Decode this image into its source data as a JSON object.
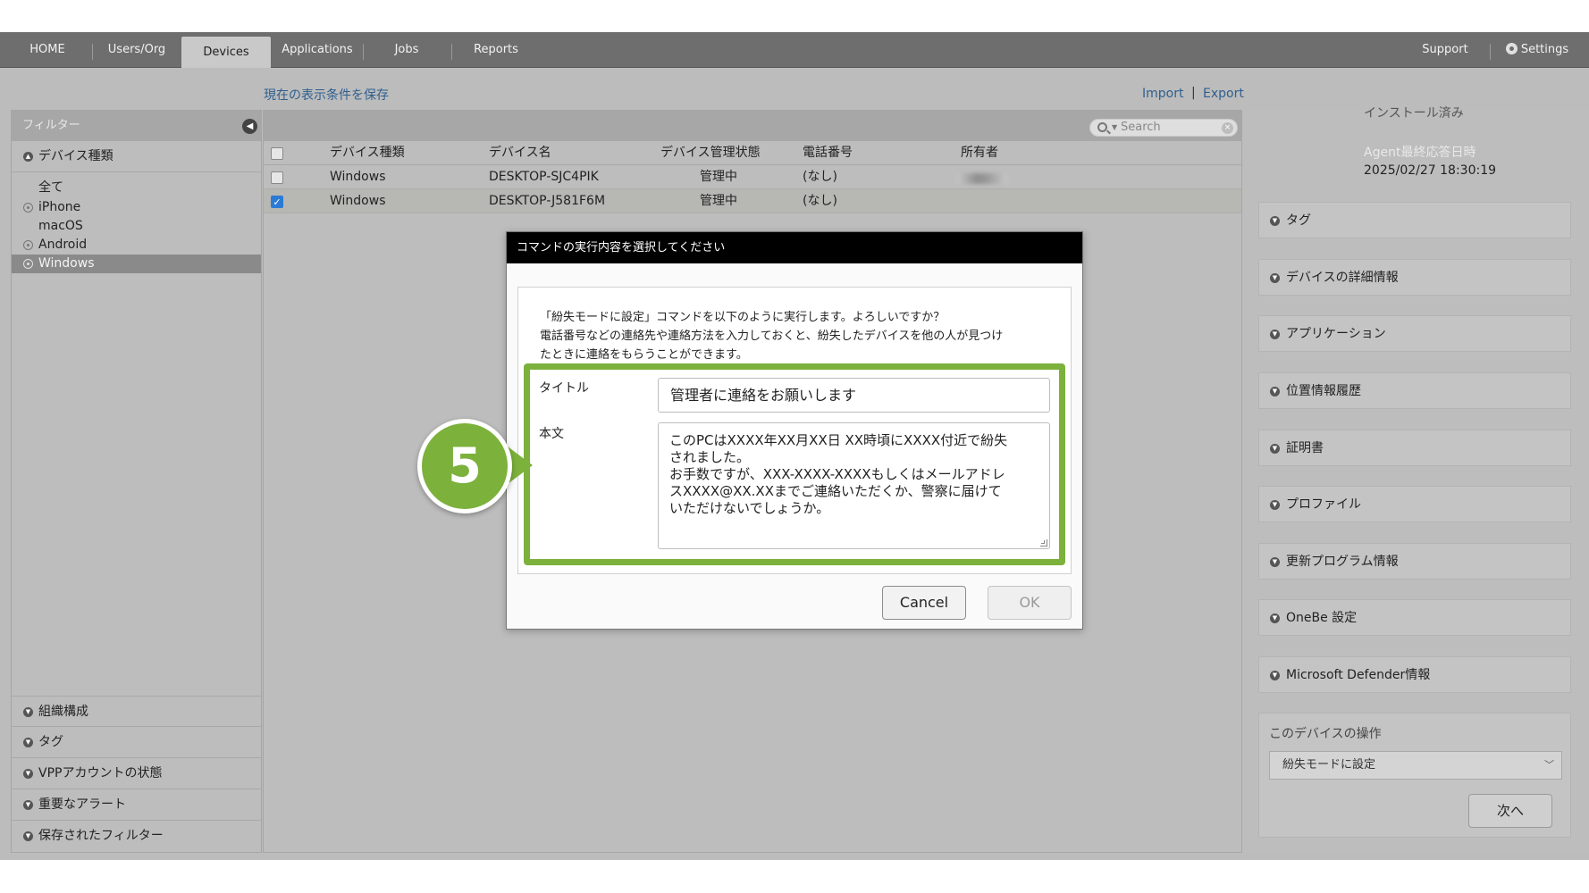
{
  "nav": {
    "items": [
      "HOME",
      "Users/Org",
      "Devices",
      "Applications",
      "Jobs",
      "Reports"
    ],
    "active": "Devices",
    "support": "Support",
    "settings": "Settings"
  },
  "toolbar": {
    "save_view": "現在の表示条件を保存",
    "import": "Import",
    "separator": "|",
    "export": "Export"
  },
  "filter": {
    "header": "フィルター",
    "device_type_label": "デバイス種類",
    "os_items": [
      "全て",
      "iPhone",
      "macOS",
      "Android",
      "Windows"
    ],
    "selected_os": "Windows",
    "bottom_sections": [
      "組織構成",
      "タグ",
      "VPPアカウントの状態",
      "重要なアラート",
      "保存されたフィルター"
    ]
  },
  "table": {
    "search_placeholder": "Search",
    "headers": [
      "デバイス種類",
      "デバイス名",
      "デバイス管理状態",
      "電話番号",
      "所有者"
    ],
    "rows": [
      {
        "type": "Windows",
        "name": "DESKTOP-SJC4PIK",
        "status": "管理中",
        "phone": "(なし)",
        "checked": false
      },
      {
        "type": "Windows",
        "name": "DESKTOP-J581F6M",
        "status": "管理中",
        "phone": "(なし)",
        "checked": true
      }
    ]
  },
  "details": {
    "install_status": "インストール済み",
    "agent_label": "Agent最終応答日時",
    "agent_value": "2025/02/27 18:30:19",
    "sections": [
      "タグ",
      "デバイスの詳細情報",
      "アプリケーション",
      "位置情報履歴",
      "証明書",
      "プロファイル",
      "更新プログラム情報",
      "OneBe 設定",
      "Microsoft Defender情報"
    ],
    "ops_title": "このデバイスの操作",
    "ops_selected": "紛失モードに設定",
    "next_button": "次へ"
  },
  "modal": {
    "title": "コマンドの実行内容を選択してください",
    "desc_line1": "「紛失モードに設定」コマンドを以下のように実行します。よろしいですか？",
    "desc_line2": "電話番号などの連絡先や連絡方法を入力しておくと、紛失したデバイスを他の人が見つけ",
    "desc_line3": "たときに連絡をもらうことができます。",
    "title_label": "タイトル",
    "title_value": "管理者に連絡をお願いします",
    "body_label": "本文",
    "body_value": "このPCはXXXX年XX月XX日 XX時頃にXXXX付近で紛失\nされました。\nお手数ですが、XXX-XXXX-XXXXもしくはメールアドレ\nスXXXX@XX.XXまでご連絡いただくか、警察に届けて\nいただけないでしょうか。",
    "cancel": "Cancel",
    "ok": "OK"
  },
  "step_badge": "5",
  "colors": {
    "accent_green": "#7cb13c",
    "navbar": "#6e6e6e",
    "checkbox_blue": "#2b7bd4",
    "link_blue": "#2f5f8f"
  }
}
